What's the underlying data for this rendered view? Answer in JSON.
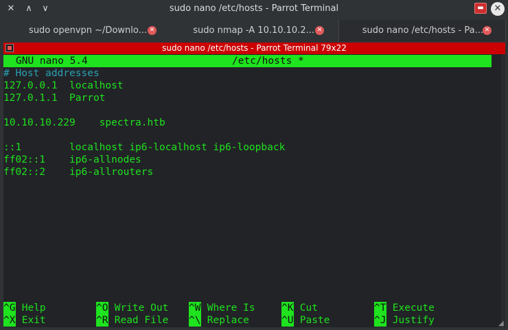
{
  "window": {
    "title": "sudo nano /etc/hosts - Parrot Terminal"
  },
  "tabs": [
    {
      "label": "sudo openvpn ~/Downlo..."
    },
    {
      "label": "sudo nmap -A 10.10.10.2..."
    },
    {
      "label": "sudo nano /etc/hosts - Pa..."
    }
  ],
  "terminal": {
    "header_title": "sudo nano /etc/hosts - Parrot Terminal 79x22",
    "nano_version": "GNU nano 5.4",
    "file_name": "/etc/hosts *",
    "lines": [
      "# Host addresses",
      "127.0.0.1  localhost",
      "127.0.1.1  Parrot",
      "",
      "10.10.10.229    spectra.htb",
      "",
      "::1        localhost ip6-localhost ip6-loopback",
      "ff02::1    ip6-allnodes",
      "ff02::2    ip6-allrouters"
    ]
  },
  "shortcuts": {
    "row1": [
      {
        "key": "^G",
        "label": "Help"
      },
      {
        "key": "^O",
        "label": "Write Out"
      },
      {
        "key": "^W",
        "label": "Where Is"
      },
      {
        "key": "^K",
        "label": "Cut"
      },
      {
        "key": "^T",
        "label": "Execute"
      }
    ],
    "row2": [
      {
        "key": "^X",
        "label": "Exit"
      },
      {
        "key": "^R",
        "label": "Read File"
      },
      {
        "key": "^\\",
        "label": "Replace"
      },
      {
        "key": "^U",
        "label": "Paste"
      },
      {
        "key": "^J",
        "label": "Justify"
      }
    ]
  },
  "colors": {
    "nano_green": "#1ee31e",
    "comment_cyan": "#2aa1b3",
    "header_red": "#cc0000",
    "terminal_bg": "#222327"
  }
}
